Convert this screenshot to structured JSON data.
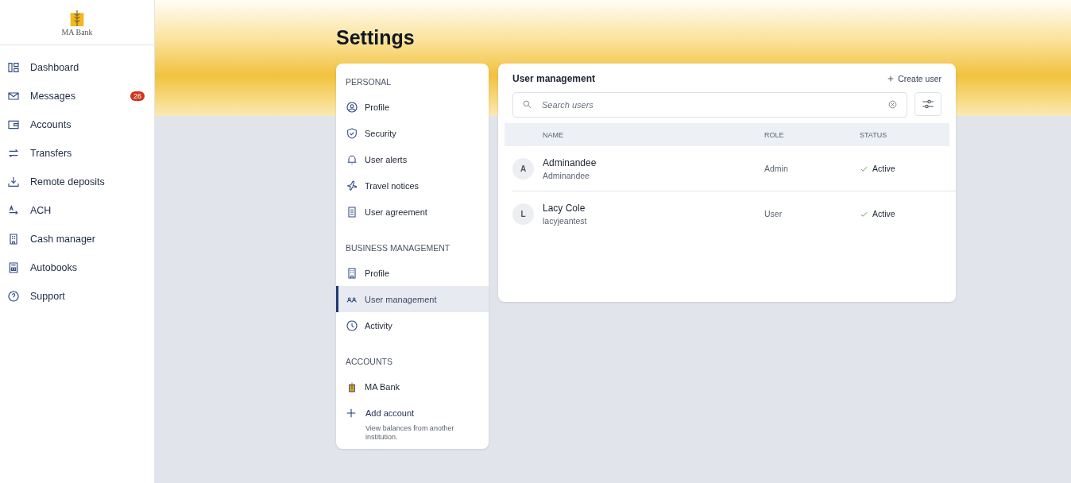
{
  "brand": {
    "name": "MA Bank"
  },
  "nav": [
    {
      "label": "Dashboard",
      "selected": false
    },
    {
      "label": "Messages",
      "selected": false,
      "badge": "26"
    },
    {
      "label": "Accounts",
      "selected": false
    },
    {
      "label": "Transfers",
      "selected": false
    },
    {
      "label": "Remote deposits",
      "selected": false
    },
    {
      "label": "ACH",
      "selected": false
    },
    {
      "label": "Cash manager",
      "selected": false
    },
    {
      "label": "Autobooks",
      "selected": false
    },
    {
      "label": "Support",
      "selected": false
    }
  ],
  "page_title": "Settings",
  "settings_menu": [
    {
      "heading": "PERSONAL",
      "items": [
        {
          "label": "Profile",
          "selected": false
        },
        {
          "label": "Security",
          "selected": false
        },
        {
          "label": "User alerts",
          "selected": false
        },
        {
          "label": "Travel notices",
          "selected": false
        },
        {
          "label": "User agreement",
          "selected": false
        }
      ]
    },
    {
      "heading": "BUSINESS MANAGEMENT",
      "items": [
        {
          "label": "Profile",
          "selected": false
        },
        {
          "label": "User management",
          "selected": true
        },
        {
          "label": "Activity",
          "selected": false
        }
      ]
    },
    {
      "heading": "ACCOUNTS",
      "items": [
        {
          "label": "MA Bank",
          "selected": false
        }
      ]
    }
  ],
  "add_account": {
    "label": "Add account",
    "description": "View balances from another institution."
  },
  "panel": {
    "title": "User management",
    "create_button": "Create user",
    "search": {
      "placeholder": "Search users"
    },
    "columns": [
      "NAME",
      "ROLE",
      "STATUS"
    ],
    "rows": [
      {
        "initial": "A",
        "name": "Adminandee",
        "username": "Adminandee",
        "role": "Admin",
        "status": "Active"
      },
      {
        "initial": "L",
        "name": "Lacy Cole",
        "username": "lacyjeantest",
        "role": "User",
        "status": "Active"
      }
    ]
  }
}
